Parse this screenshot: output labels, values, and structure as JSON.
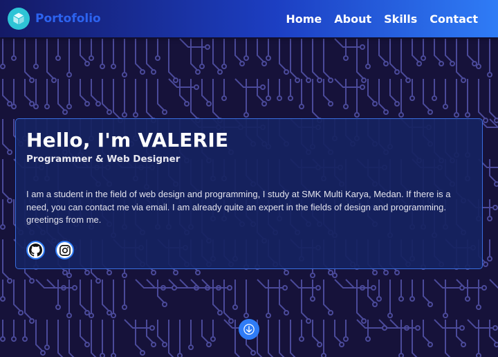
{
  "navbar": {
    "brand": "Portofolio",
    "logo_icon": "cube-icon",
    "links": [
      "Home",
      "About",
      "Skills",
      "Contact"
    ]
  },
  "hero": {
    "title": "Hello, I'm VALERIE",
    "subtitle": "Programmer & Web Designer",
    "description": "I am a student in the field of web design and programming, I study at SMK Multi Karya, Medan. If there is a need, you can contact me via email. I am already quite an expert in the fields of design and programming. greetings from me.",
    "socials": [
      "github-icon",
      "instagram-icon"
    ]
  },
  "scroll_down_icon": "arrow-down-icon",
  "colors": {
    "background": "#16123a",
    "circuit": "#4b4a9a",
    "accent": "#2f7cf6",
    "brand_text": "#2c63f0",
    "logo": "#2ec4d6"
  }
}
